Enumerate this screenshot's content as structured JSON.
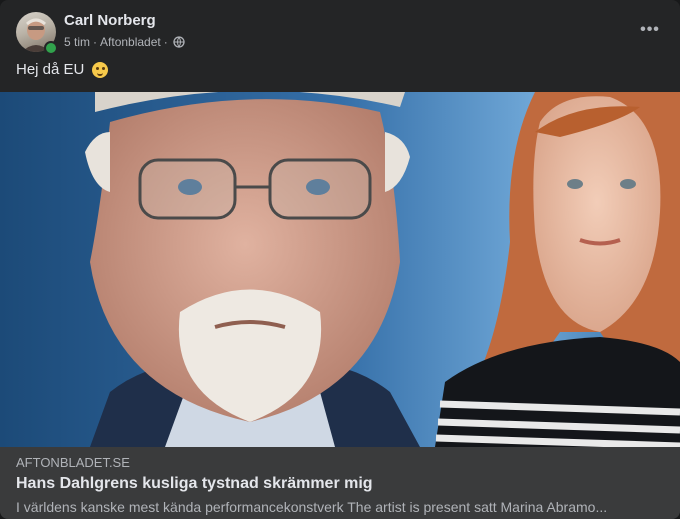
{
  "post": {
    "author": "Carl Norberg",
    "time": "5 tim",
    "separator": "·",
    "source": "Aftonbladet",
    "privacy_icon": "globe-icon",
    "more_icon": "more-options-icon",
    "text": "Hej då EU",
    "emoji": "winking-face-emoji"
  },
  "link": {
    "domain": "AFTONBLADET.SE",
    "title": "Hans Dahlgrens kusliga tystnad skrämmer mig",
    "description": "I världens kanske mest kända performancekonstverk The artist is present satt Marina Abramo..."
  },
  "colors": {
    "card_bg": "#242526",
    "footer_bg": "#3a3b3c",
    "text_primary": "#e4e6eb",
    "text_secondary": "#b0b3b8",
    "online": "#31a24c"
  }
}
